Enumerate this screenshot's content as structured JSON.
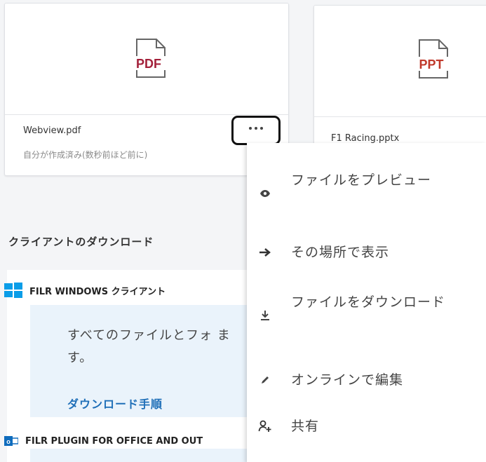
{
  "files": [
    {
      "name": "Webview.pdf",
      "meta": "自分が作成済み(数秒前ほど前に)",
      "badge": "PDF",
      "badge_color": "#a3203a"
    },
    {
      "name": "F1 Racing.pptx",
      "meta": "",
      "badge": "PPT",
      "badge_color": "#c0392b"
    }
  ],
  "clients_section": {
    "title": "クライアントのダウンロード",
    "windows": {
      "label": "FILR WINDOWS クライアント"
    },
    "description": "すべてのファイルとフォ ます。",
    "download_link": "ダウンロード手順",
    "plugin": {
      "label": "FILR PLUGIN FOR OFFICE AND OUT"
    }
  },
  "context_menu": {
    "items": [
      {
        "label": "ファイルをプレビュー",
        "icon": "eye-icon"
      },
      {
        "label": "その場所で表示",
        "icon": "arrow-right-icon"
      },
      {
        "label": "ファイルをダウンロード",
        "icon": "download-icon"
      },
      {
        "label": "オンラインで編集",
        "icon": "pencil-icon"
      },
      {
        "label": "共有",
        "icon": "share-user-icon"
      }
    ]
  },
  "colors": {
    "accent_link": "#1f6fb8",
    "windows_blue": "#0a9de8",
    "outlook_blue": "#0f6cbd"
  }
}
